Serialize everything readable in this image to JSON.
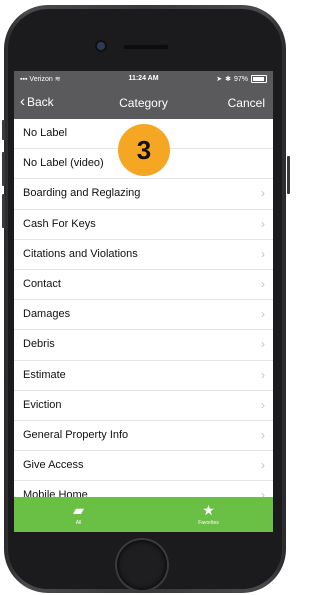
{
  "status_bar": {
    "carrier": "Verizon",
    "time": "11:24 AM",
    "battery": "97%"
  },
  "nav": {
    "back_label": "Back",
    "title": "Category",
    "cancel_label": "Cancel"
  },
  "items": [
    {
      "label": "No Label",
      "has_arrow": false
    },
    {
      "label": "No Label (video)",
      "has_arrow": false
    },
    {
      "label": "Boarding and Reglazing",
      "has_arrow": true
    },
    {
      "label": "Cash For Keys",
      "has_arrow": true
    },
    {
      "label": "Citations and Violations",
      "has_arrow": true
    },
    {
      "label": "Contact",
      "has_arrow": true
    },
    {
      "label": "Damages",
      "has_arrow": true
    },
    {
      "label": "Debris",
      "has_arrow": true
    },
    {
      "label": "Estimate",
      "has_arrow": true
    },
    {
      "label": "Eviction",
      "has_arrow": true
    },
    {
      "label": "General Property Info",
      "has_arrow": true
    },
    {
      "label": "Give Access",
      "has_arrow": true
    },
    {
      "label": "Mobile Home",
      "has_arrow": true
    }
  ],
  "step_badge": "3",
  "tabs": [
    {
      "label": "All",
      "icon": "cards-icon"
    },
    {
      "label": "Favorites",
      "icon": "star-icon"
    }
  ],
  "colors": {
    "nav_bg": "#5a5a5d",
    "tab_bg": "#6abf45",
    "badge": "#f5a623"
  }
}
